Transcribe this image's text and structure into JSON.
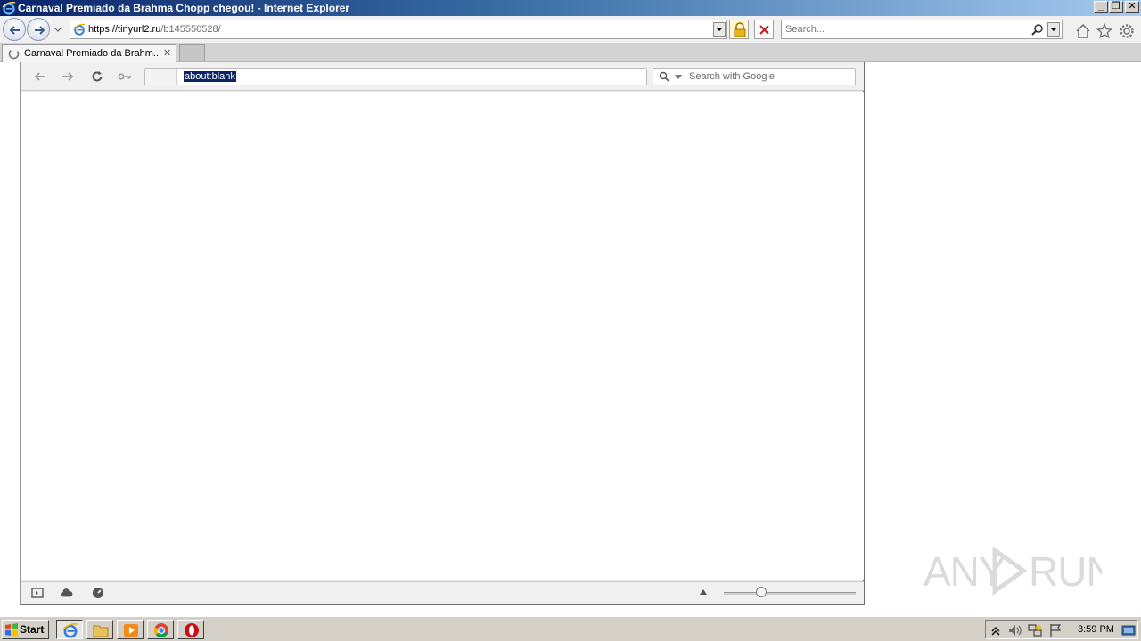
{
  "window": {
    "title": "Carnaval Premiado da Brahma Chopp chegou! - Internet Explorer",
    "controls": {
      "minimize": "_",
      "maximize": "❐",
      "close": "✕"
    }
  },
  "ie": {
    "address": {
      "host": "https://tinyurl2.ru",
      "path": "/b145550528/"
    },
    "search_placeholder": "Search...",
    "tab": {
      "label": "Carnaval Premiado da Brahm...",
      "close": "✕"
    }
  },
  "inner_browser": {
    "url_value": "about:blank",
    "search_placeholder": "Search with Google"
  },
  "watermark": {
    "text": "ANY RUN"
  },
  "taskbar": {
    "start_label": "Start",
    "clock": "3:59 PM"
  },
  "icons": {
    "ie": "ie-icon",
    "back": "back-arrow-icon",
    "forward": "forward-arrow-icon",
    "lock": "lock-icon",
    "stop": "close-icon",
    "search": "search-icon",
    "home": "home-icon",
    "favorites": "star-icon",
    "tools": "gear-icon",
    "reload": "reload-icon",
    "key": "key-icon",
    "cloud": "cloud-icon",
    "speedometer": "speedometer-icon",
    "sidebar": "sidebar-icon",
    "explorer": "folder-icon",
    "media": "media-player-icon",
    "chrome": "chrome-icon",
    "opera": "opera-icon",
    "volume": "speaker-icon",
    "network": "network-icon",
    "flag": "flag-icon"
  },
  "colors": {
    "titlebar_start": "#0a246a",
    "titlebar_end": "#a6caf0",
    "selection": "#0a246a",
    "taskbar": "#d4d0c8"
  }
}
